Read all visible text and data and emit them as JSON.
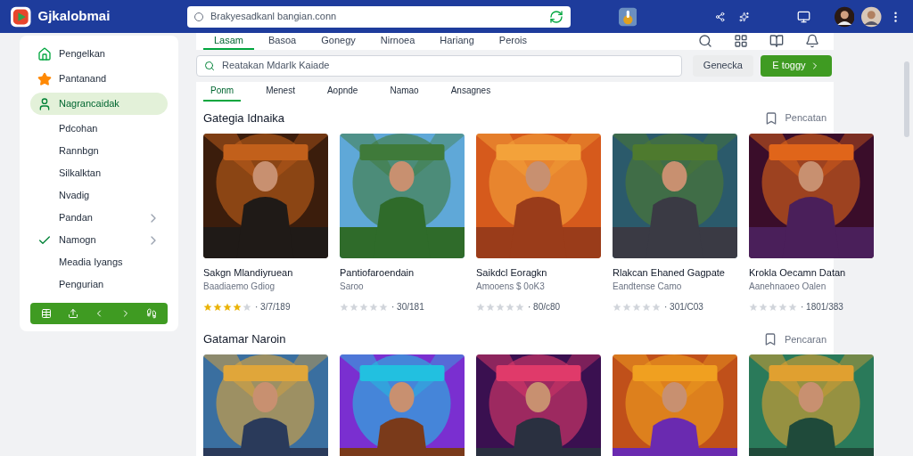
{
  "header": {
    "brand": "Gjkalobmai",
    "address": "Brakyesadkanl bangian.conn"
  },
  "sidebar": {
    "items": [
      {
        "label": "Pengelkan",
        "kind": "home",
        "selected": false
      },
      {
        "label": "Pantanand",
        "kind": "star",
        "selected": false
      },
      {
        "label": "Nagrancaidak",
        "kind": "person",
        "selected": true
      },
      {
        "label": "Pdcohan",
        "kind": "plain",
        "selected": false
      },
      {
        "label": "Rannbgn",
        "kind": "plain",
        "selected": false
      },
      {
        "label": "Silkalktan",
        "kind": "plain",
        "selected": false
      },
      {
        "label": "Nvadig",
        "kind": "plain",
        "selected": false
      },
      {
        "label": "Pandan",
        "kind": "submenu",
        "selected": false
      },
      {
        "label": "Namogn",
        "kind": "checked",
        "selected": false
      },
      {
        "label": "Meadia Iyangs",
        "kind": "plain",
        "selected": false
      },
      {
        "label": "Pengurian",
        "kind": "plain",
        "selected": false
      }
    ]
  },
  "tabs": [
    {
      "label": "Lasam",
      "selected": true
    },
    {
      "label": "Basoa",
      "selected": false
    },
    {
      "label": "Gonegy",
      "selected": false
    },
    {
      "label": "Nirnoea",
      "selected": false
    },
    {
      "label": "Hariang",
      "selected": false
    },
    {
      "label": "Perois",
      "selected": false
    }
  ],
  "search": {
    "placeholder": "Reatakan Mdarlk Kaiade",
    "secondary_button": "Genecka",
    "primary_button": "E toggy"
  },
  "subtabs": [
    {
      "label": "Ponm",
      "selected": true
    },
    {
      "label": "Menest",
      "selected": false
    },
    {
      "label": "Aopnde",
      "selected": false
    },
    {
      "label": "Namao",
      "selected": false
    },
    {
      "label": "Ansagnes",
      "selected": false
    }
  ],
  "sections": [
    {
      "title": "Gategia Idnaika",
      "link": "Pencatan",
      "cards": [
        {
          "kind": "game",
          "title": "Sakgn Mlandiyruean",
          "subtitle": "Baadiaemo Gdiog",
          "stars": 4,
          "count": "· 3/7/189"
        },
        {
          "kind": "game",
          "title": "Pantiofaroendain",
          "subtitle": "Saroo",
          "stars": 0,
          "count": "· 30/181"
        },
        {
          "kind": "game",
          "title": "Saikdcl Eoragkn",
          "subtitle": "Amooens $ 0oK3",
          "stars": 0,
          "count": "· 80/c80"
        },
        {
          "kind": "game",
          "title": "Rlakcan Ehaned Gagpate",
          "subtitle": "Eandtense Camo",
          "stars": 0,
          "count": "· 301/C03"
        },
        {
          "kind": "game",
          "title": "Krokla Oecamn Datan",
          "subtitle": "Aanehnaoeo Oalen",
          "stars": 0,
          "count": "· 1801/383"
        }
      ]
    },
    {
      "title": "Gatamar Naroin",
      "link": "Pencaran"
    }
  ]
}
